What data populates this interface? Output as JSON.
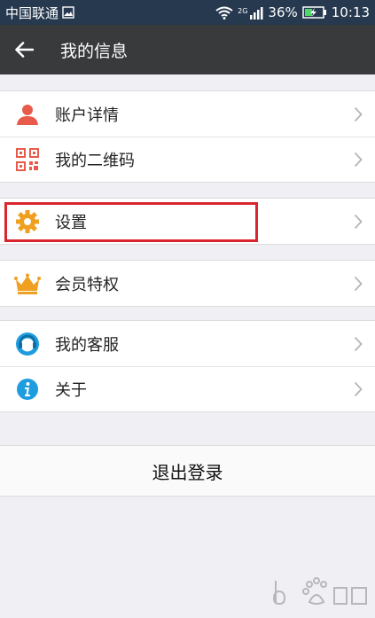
{
  "status_bar": {
    "carrier": "中国联通",
    "network": "2G",
    "battery": "36%",
    "time": "10:13"
  },
  "header": {
    "title": "我的信息"
  },
  "menu": {
    "group1": [
      {
        "label": "账户详情",
        "icon": "person-icon"
      },
      {
        "label": "我的二维码",
        "icon": "qr-code-icon"
      }
    ],
    "group2": [
      {
        "label": "设置",
        "icon": "gear-icon"
      }
    ],
    "group3": [
      {
        "label": "会员特权",
        "icon": "crown-icon"
      }
    ],
    "group4": [
      {
        "label": "我的客服",
        "icon": "customer-service-icon"
      },
      {
        "label": "关于",
        "icon": "info-icon"
      }
    ]
  },
  "logout_label": "退出登录",
  "colors": {
    "status_bar": "#26394f",
    "title_bar": "#393a3c",
    "background": "#efeff4",
    "highlight": "#d9262c",
    "person": "#e85b4b",
    "gear": "#f0a020",
    "crown": "#f0a020",
    "info": "#1e9ce0"
  }
}
